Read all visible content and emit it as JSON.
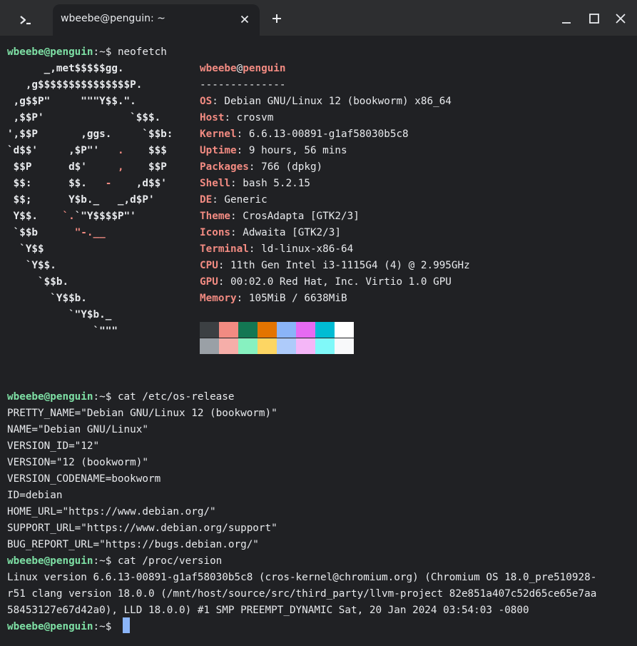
{
  "window": {
    "tab_title": "wbeebe@penguin: ~"
  },
  "icons": {
    "home_tab": "terminal-prompt-icon",
    "tab_close": "close-icon",
    "new_tab": "plus-icon",
    "minimize": "minimize-icon",
    "maximize": "maximize-icon",
    "close": "close-icon"
  },
  "prompt": {
    "user": "wbeebe@penguin",
    "path": ":~$ "
  },
  "commands": {
    "neofetch": "neofetch",
    "os_release": "cat /etc/os-release",
    "version": "cat /proc/version"
  },
  "ascii_art": [
    [
      {
        "t": "      _,met$$$$$gg.",
        "r": false
      }
    ],
    [
      {
        "t": "   ,g$$$$$$$$$$$$$$$P.",
        "r": false
      }
    ],
    [
      {
        "t": " ,g$$P\"     \"\"\"Y$$.\".",
        "r": false
      }
    ],
    [
      {
        "t": " ,$$P'              `$$$.",
        "r": false
      }
    ],
    [
      {
        "t": "',$$P       ,ggs.     `$$b:",
        "r": false
      }
    ],
    [
      {
        "t": "`d$$'     ,$P\"'   ",
        "r": false
      },
      {
        "t": ".",
        "r": true
      },
      {
        "t": "    $$$",
        "r": false
      }
    ],
    [
      {
        "t": " $$P      d$'     ",
        "r": false
      },
      {
        "t": ",",
        "r": true
      },
      {
        "t": "    $$P",
        "r": false
      }
    ],
    [
      {
        "t": " $$:      $$.   ",
        "r": false
      },
      {
        "t": "-",
        "r": true
      },
      {
        "t": "    ,d$$'",
        "r": false
      }
    ],
    [
      {
        "t": " $$;      Y$b._   _,d$P'",
        "r": false
      }
    ],
    [
      {
        "t": " Y$$.    ",
        "r": false
      },
      {
        "t": "`.",
        "r": true
      },
      {
        "t": "`\"Y$$$$P\"'",
        "r": false
      }
    ],
    [
      {
        "t": " `$$b      ",
        "r": false
      },
      {
        "t": "\"-.__",
        "r": true
      }
    ],
    [
      {
        "t": "  `Y$$",
        "r": false
      }
    ],
    [
      {
        "t": "   `Y$$.",
        "r": false
      }
    ],
    [
      {
        "t": "     `$$b.",
        "r": false
      }
    ],
    [
      {
        "t": "       `Y$$b.",
        "r": false
      }
    ],
    [
      {
        "t": "          `\"Y$b._",
        "r": false
      }
    ],
    [
      {
        "t": "              `\"\"\"",
        "r": false
      }
    ]
  ],
  "neofetch": {
    "header_user": "wbeebe",
    "header_at": "@",
    "header_host": "penguin",
    "divider": "--------------",
    "info": [
      {
        "key": "OS",
        "value": ": Debian GNU/Linux 12 (bookworm) x86_64"
      },
      {
        "key": "Host",
        "value": ": crosvm"
      },
      {
        "key": "Kernel",
        "value": ": 6.6.13-00891-g1af58030b5c8"
      },
      {
        "key": "Uptime",
        "value": ": 9 hours, 56 mins"
      },
      {
        "key": "Packages",
        "value": ": 766 (dpkg)"
      },
      {
        "key": "Shell",
        "value": ": bash 5.2.15"
      },
      {
        "key": "DE",
        "value": ": Generic"
      },
      {
        "key": "Theme",
        "value": ": CrosAdapta [GTK2/3]"
      },
      {
        "key": "Icons",
        "value": ": Adwaita [GTK2/3]"
      },
      {
        "key": "Terminal",
        "value": ": ld-linux-x86-64"
      },
      {
        "key": "CPU",
        "value": ": 11th Gen Intel i3-1115G4 (4) @ 2.995GHz"
      },
      {
        "key": "GPU",
        "value": ": 00:02.0 Red Hat, Inc. Virtio 1.0 GPU"
      },
      {
        "key": "Memory",
        "value": ": 105MiB / 6638MiB"
      }
    ],
    "palette_row1": [
      "#3c4043",
      "#f28b82",
      "#137753",
      "#e37400",
      "#8ab4f8",
      "#e66af2",
      "#00bcd4",
      "#ffffff"
    ],
    "palette_row2": [
      "#9aa0a6",
      "#f6aea9",
      "#87f1c0",
      "#fdd663",
      "#aecbfa",
      "#f4b6f7",
      "#80f9f9",
      "#f8f9fa"
    ]
  },
  "os_release_lines": [
    "PRETTY_NAME=\"Debian GNU/Linux 12 (bookworm)\"",
    "NAME=\"Debian GNU/Linux\"",
    "VERSION_ID=\"12\"",
    "VERSION=\"12 (bookworm)\"",
    "VERSION_CODENAME=bookworm",
    "ID=debian",
    "HOME_URL=\"https://www.debian.org/\"",
    "SUPPORT_URL=\"https://www.debian.org/support\"",
    "BUG_REPORT_URL=\"https://bugs.debian.org/\""
  ],
  "version_lines": [
    "Linux version 6.6.13-00891-g1af58030b5c8 (cros-kernel@chromium.org) (Chromium OS 18.0_pre510928-",
    "r51 clang version 18.0.0 (/mnt/host/source/src/third_party/llvm-project 82e851a407c52d65ce65e7aa",
    "58453127e67d42a0), LLD 18.0.0) #1 SMP PREEMPT_DYNAMIC Sat, 20 Jan 2024 03:54:03 -0800"
  ],
  "colors": {
    "accent_user": "#7ee0a5",
    "accent_key": "#f28b82",
    "cursor": "#8ab4f8"
  }
}
